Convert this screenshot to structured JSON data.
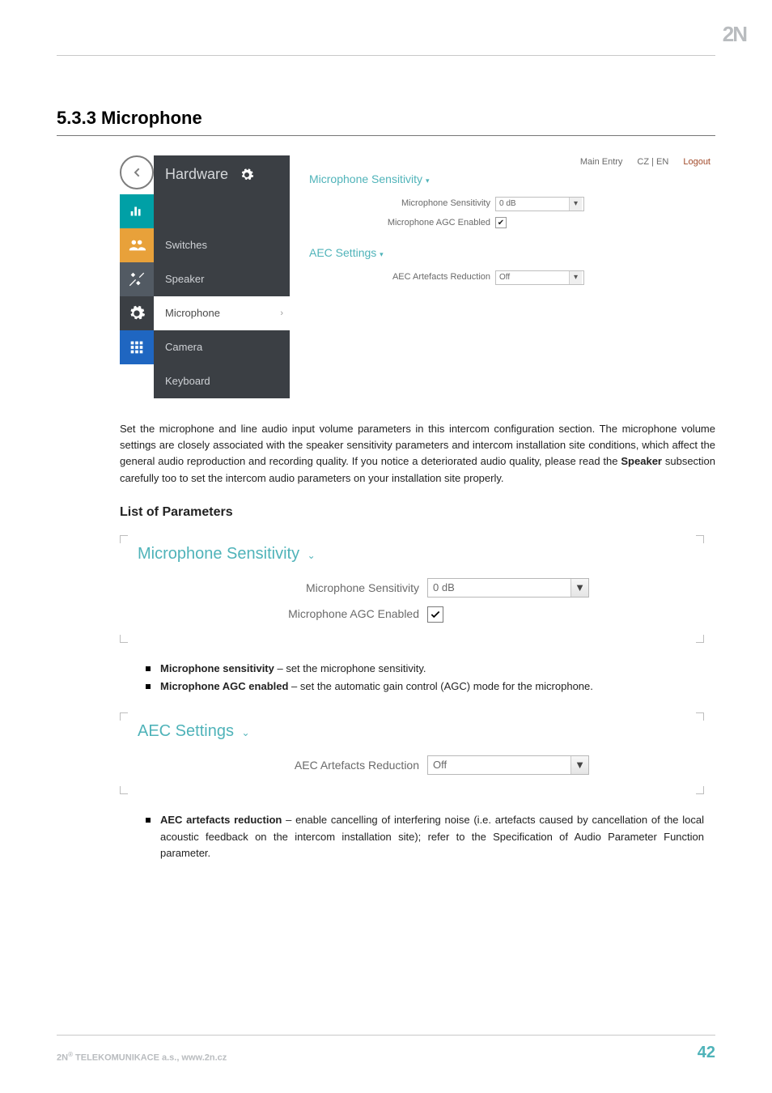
{
  "brand": "2N",
  "heading": "5.3.3 Microphone",
  "shot": {
    "topbar": {
      "main": "Main Entry",
      "lang": "CZ | EN",
      "logout": "Logout"
    },
    "hardware_label": "Hardware",
    "sidebar": {
      "switches": "Switches",
      "speaker": "Speaker",
      "microphone": "Microphone",
      "camera": "Camera",
      "keyboard": "Keyboard"
    },
    "group1": {
      "title": "Microphone Sensitivity",
      "sens_label": "Microphone Sensitivity",
      "sens_value": "0 dB",
      "agc_label": "Microphone AGC Enabled"
    },
    "group2": {
      "title": "AEC Settings",
      "art_label": "AEC Artefacts Reduction",
      "art_value": "Off"
    }
  },
  "para1_a": "Set the microphone and line audio input volume parameters in this intercom configuration section. The microphone volume settings are closely associated with the speaker sensitivity parameters and intercom installation site conditions, which affect the general audio reproduction and recording quality. If you notice a deteriorated audio quality, please read the ",
  "para1_bold": "Speaker",
  "para1_b": " subsection carefully too to set the intercom audio parameters on your installation site properly.",
  "subheading": "List of Parameters",
  "panel1": {
    "title": "Microphone Sensitivity",
    "sens_label": "Microphone Sensitivity",
    "sens_value": "0 dB",
    "agc_label": "Microphone AGC Enabled"
  },
  "bullets1": {
    "b1_bold": "Microphone sensitivity",
    "b1_rest": " – set the microphone sensitivity.",
    "b2_bold": "Microphone AGC enabled",
    "b2_rest": " – set the automatic gain control (AGC) mode for the microphone."
  },
  "panel2": {
    "title": "AEC Settings",
    "art_label": "AEC Artefacts Reduction",
    "art_value": "Off"
  },
  "bullets2": {
    "b1_bold": "AEC artefacts reduction",
    "b1_rest": " – enable cancelling of interfering noise (i.e. artefacts caused by cancellation of the local acoustic feedback on the intercom installation site); refer to the Specification of Audio Parameter Function parameter."
  },
  "footer": {
    "left_a": "2N",
    "left_b": " TELEKOMUNIKACE a.s., www.2n.cz",
    "page": "42"
  }
}
